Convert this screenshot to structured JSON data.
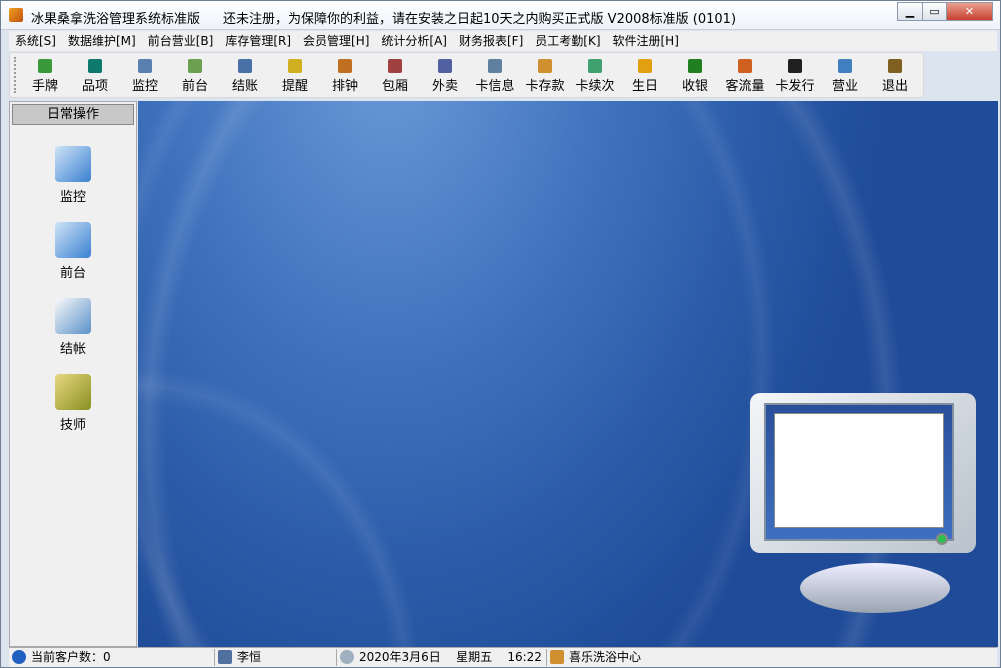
{
  "window": {
    "title": "冰果桑拿洗浴管理系统标准版",
    "notice": "还未注册，为保障你的利益，请在安装之日起10天之内购买正式版   V2008标准版 (0101)",
    "controls": [
      "minimize",
      "maximize",
      "close"
    ]
  },
  "menu": [
    "系统[S]",
    "数据维护[M]",
    "前台营业[B]",
    "库存管理[R]",
    "会员管理[H]",
    "统计分析[A]",
    "财务报表[F]",
    "员工考勤[K]",
    "软件注册[H]"
  ],
  "toolbar": [
    {
      "label": "手牌",
      "icon": "hand-tag-icon",
      "color": "#3a9a3a"
    },
    {
      "label": "品项",
      "icon": "database-icon",
      "color": "#0e7a6e"
    },
    {
      "label": "监控",
      "icon": "grid-monitor-icon",
      "color": "#5a80b0"
    },
    {
      "label": "前台",
      "icon": "calendar-icon",
      "color": "#6aa050"
    },
    {
      "label": "结账",
      "icon": "calculator-icon",
      "color": "#4a70a8"
    },
    {
      "label": "提醒",
      "icon": "alarm-clock-icon",
      "color": "#d0b020"
    },
    {
      "label": "排钟",
      "icon": "list-icon",
      "color": "#c07020"
    },
    {
      "label": "包厢",
      "icon": "room-icon",
      "color": "#a04040"
    },
    {
      "label": "外卖",
      "icon": "takeout-icon",
      "color": "#5060a0"
    },
    {
      "label": "卡信息",
      "icon": "card-info-icon",
      "color": "#6080a0"
    },
    {
      "label": "卡存款",
      "icon": "card-deposit-icon",
      "color": "#d09030"
    },
    {
      "label": "卡续次",
      "icon": "card-renew-icon",
      "color": "#40a070"
    },
    {
      "label": "生日",
      "icon": "gift-icon",
      "color": "#e0a010"
    },
    {
      "label": "收银",
      "icon": "dollar-icon",
      "color": "#208020"
    },
    {
      "label": "客流量",
      "icon": "bar-chart-icon",
      "color": "#d06020"
    },
    {
      "label": "卡发行",
      "icon": "runner-icon",
      "color": "#202020"
    },
    {
      "label": "营业",
      "icon": "sliders-icon",
      "color": "#4080c0"
    },
    {
      "label": "退出",
      "icon": "exit-door-icon",
      "color": "#806020"
    }
  ],
  "left_panel": {
    "header": "日常操作",
    "items": [
      {
        "label": "监控",
        "icon": "computer-icon"
      },
      {
        "label": "前台",
        "icon": "computer-icon"
      },
      {
        "label": "结帐",
        "icon": "printer-icon"
      },
      {
        "label": "技师",
        "icon": "number-keypad-icon"
      }
    ]
  },
  "status": {
    "customers": "当前客户数：0",
    "user": "李恒",
    "date": "2020年3月6日",
    "weekday": "星期五",
    "time": "16:22",
    "venue": "喜乐洗浴中心"
  }
}
